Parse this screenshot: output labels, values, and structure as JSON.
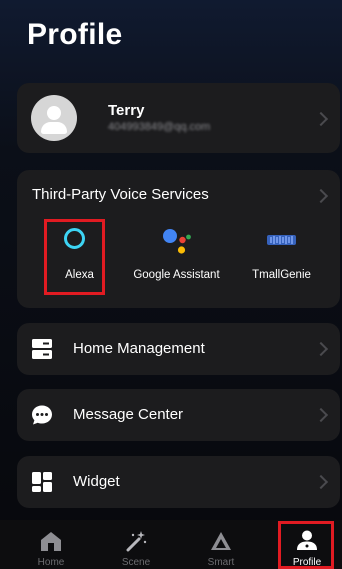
{
  "page": {
    "title": "Profile"
  },
  "user": {
    "name": "Terry",
    "email": "404993849@qq.com"
  },
  "voice_services": {
    "title": "Third-Party Voice Services",
    "items": [
      {
        "label": "Alexa"
      },
      {
        "label": "Google Assistant"
      },
      {
        "label": "TmallGenie"
      }
    ]
  },
  "menu": [
    {
      "label": "Home Management"
    },
    {
      "label": "Message Center"
    },
    {
      "label": "Widget"
    }
  ],
  "tabbar": [
    {
      "label": "Home"
    },
    {
      "label": "Scene"
    },
    {
      "label": "Smart"
    },
    {
      "label": "Profile"
    }
  ],
  "colors": {
    "highlight": "#e11b22",
    "alexa": "#3dd4f4",
    "google_blue": "#4285F4",
    "google_red": "#EA4335",
    "google_yellow": "#FBBC05",
    "google_green": "#34A853",
    "tmall": "#3b6fd8"
  }
}
